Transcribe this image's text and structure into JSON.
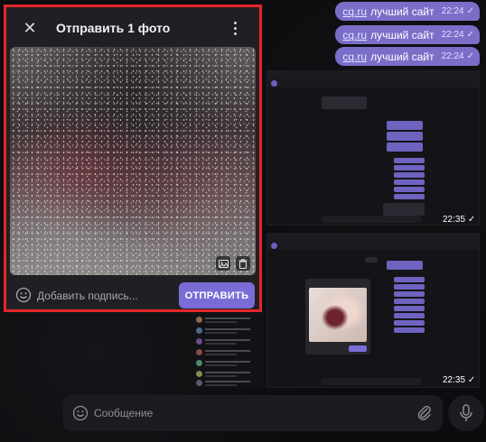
{
  "dialog": {
    "title": "Отправить 1 фото",
    "caption_placeholder": "Добавить подпись...",
    "send_label": "ОТПРАВИТЬ"
  },
  "messages": [
    {
      "link": "cq.ru",
      "text": "лучший сайт",
      "time": "22:24"
    },
    {
      "link": "cq.ru",
      "text": "лучший сайт",
      "time": "22:24"
    },
    {
      "link": "cq.ru",
      "text": "лучший сайт",
      "time": "22:24"
    }
  ],
  "screenshot_times": [
    "22:35",
    "22:35"
  ],
  "composer": {
    "placeholder": "Сообщение"
  },
  "colors": {
    "accent": "#7a6cd6",
    "highlight_border": "#e3262b",
    "bubble": "#7a6ec9"
  }
}
